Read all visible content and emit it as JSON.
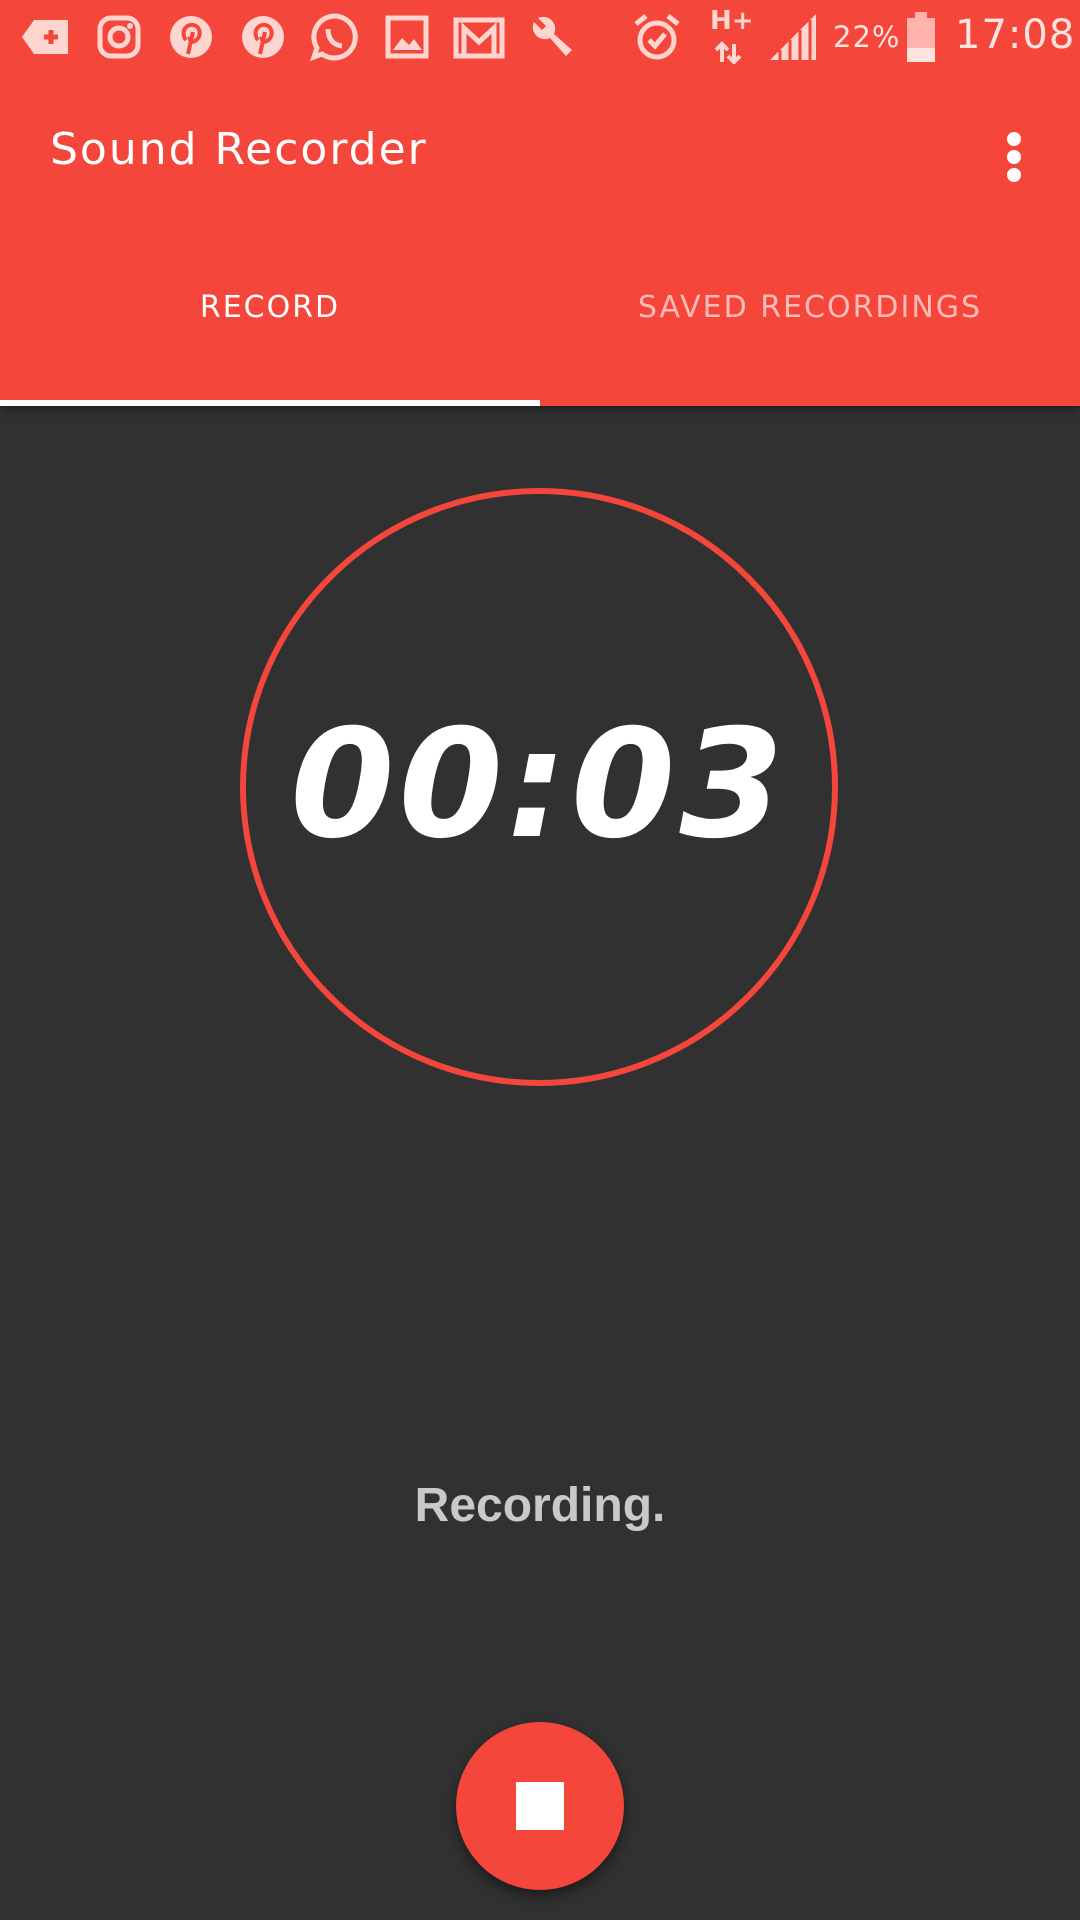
{
  "status_bar": {
    "icons": [
      "tag-plus-icon",
      "instagram-icon",
      "pinterest-icon",
      "pinterest-icon",
      "whatsapp-icon",
      "image-icon",
      "gmail-icon",
      "wrench-icon",
      "alarm-icon",
      "network-hplus-icon",
      "signal-icon",
      "battery-icon"
    ],
    "network_label": "H+",
    "battery_percent": "22%",
    "time": "17:08"
  },
  "app": {
    "title": "Sound Recorder",
    "menu_icon": "more-vert-icon"
  },
  "tabs": [
    {
      "label": "RECORD",
      "selected": true
    },
    {
      "label": "SAVED RECORDINGS",
      "selected": false
    }
  ],
  "timer": {
    "value": "00:03"
  },
  "status": {
    "text": "Recording."
  },
  "controls": {
    "stop_icon": "stop-icon"
  },
  "colors": {
    "accent": "#f4463b",
    "background": "#313131"
  }
}
